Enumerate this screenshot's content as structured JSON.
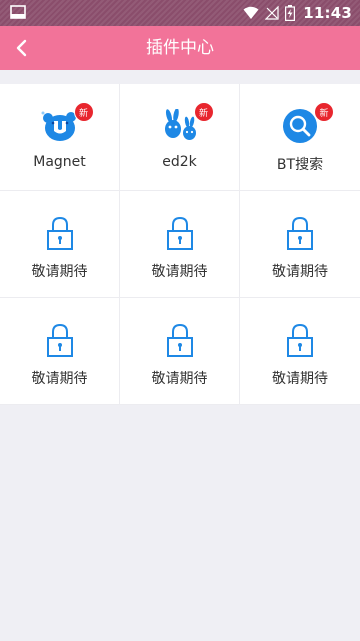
{
  "status_bar": {
    "time": "11:43"
  },
  "app_bar": {
    "title": "插件中心"
  },
  "plugins": [
    {
      "label": "Magnet",
      "icon": "magnet-bear-icon",
      "badge": "新"
    },
    {
      "label": "ed2k",
      "icon": "ed2k-rabbit-icon",
      "badge": "新"
    },
    {
      "label": "BT搜索",
      "icon": "bt-search-icon",
      "badge": "新"
    },
    {
      "label": "敬请期待",
      "icon": "lock-icon"
    },
    {
      "label": "敬请期待",
      "icon": "lock-icon"
    },
    {
      "label": "敬请期待",
      "icon": "lock-icon"
    },
    {
      "label": "敬请期待",
      "icon": "lock-icon"
    },
    {
      "label": "敬请期待",
      "icon": "lock-icon"
    },
    {
      "label": "敬请期待",
      "icon": "lock-icon"
    }
  ],
  "colors": {
    "app_bar": "#f27399",
    "accent_blue": "#1e88e5",
    "badge_red": "#e8262e"
  }
}
